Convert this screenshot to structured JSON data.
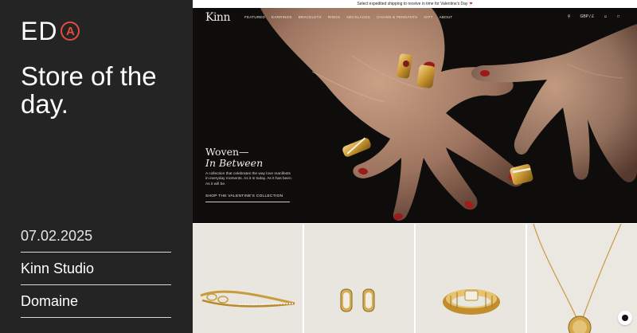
{
  "left_panel": {
    "logo_text": "ED",
    "logo_mark": "A",
    "headline": "Store of the day.",
    "date": "07.02.2025",
    "studio": "Kinn Studio",
    "category": "Domaine"
  },
  "site": {
    "announcement": "Select expedited shipping to receive in time for Valentine's Day",
    "brand": "Kinn",
    "nav": [
      "FEATURED",
      "EARRINGS",
      "BRACELETS",
      "RINGS",
      "NECKLACES",
      "CHAINS & PENDANTS",
      "GIFT",
      "ABOUT"
    ],
    "currency": "GBP / £",
    "promo": {
      "title": "Woven—",
      "title_italic": "In Between",
      "body": "A collection that celebrates the way love manifests in everyday moments. As it is today. As it has been. As it will be.",
      "cta": "SHOP THE VALENTINE'S COLLECTION"
    },
    "products": [
      {
        "name": "bracelet"
      },
      {
        "name": "hoop-earrings"
      },
      {
        "name": "ring"
      },
      {
        "name": "pendant-necklace"
      }
    ]
  },
  "colors": {
    "accent": "#e84a3f",
    "panel_bg": "#242424",
    "hero_bg": "#0e0d0c",
    "product_bg": "#e9e6e0"
  }
}
